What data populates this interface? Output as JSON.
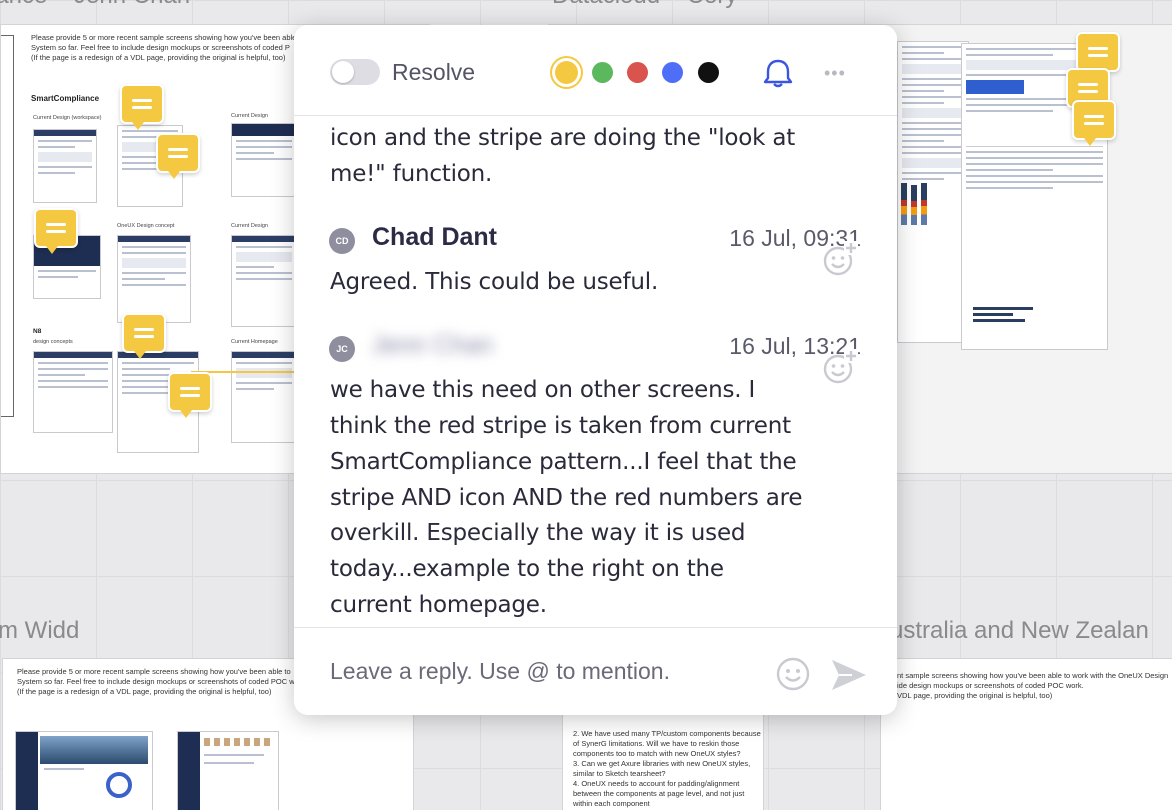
{
  "board": {
    "section_titles": [
      "iance – Jenn Chan",
      "Datacloud – Cory",
      "m Widd",
      "ustralia and New Zealan"
    ],
    "panel_left_instructions": [
      "Please provide 5 or more recent sample screens showing how you've been able",
      "System so far. Feel free to include  design mockups or screenshots of coded P",
      "(If the page is a redesign of a VDL page, providing the original is helpful, too)"
    ],
    "panel_left_heading": "SmartCompliance",
    "panel_left_labels": [
      "Current Design (workspace)",
      "Current Design",
      "OneUX Design concept",
      "Current Design"
    ],
    "panel_left_n8": "N8",
    "panel_left_n8_sub": "design concepts",
    "panel_left_homepage": "Current Homepage",
    "panel_bottom_left_instructions": [
      "Please provide 5 or more recent sample screens showing how you've been able to",
      "System so far. Feel free to include  design mockups or screenshots of coded POC w",
      "(If the page is a redesign of a VDL page, providing the original is helpful, too)"
    ],
    "panel_bottom_right_instructions": [
      "nt sample screens showing how you've been able to work with the OneUX Design",
      "ide  design mockups or screenshots of coded POC work.",
      "VDL page, providing the original is helpful, too)"
    ],
    "panel_bottom_mid_notes": [
      "2. We have used many TP/custom components because",
      "of SynerG limitations. Will we have to reskin those",
      "components too to match with new OneUX styles?",
      "3. Can we get Axure libraries with new OneUX styles,",
      "similar to Sketch tearsheet?",
      "4. OneUX needs to account for padding/alignment",
      "between the components at page level, and not just",
      "within each component"
    ]
  },
  "popup": {
    "resolve_label": "Resolve",
    "resolved": false,
    "colors": [
      "#f5c842",
      "#5cb85c",
      "#d9534f",
      "#4f6ef7",
      "#111111"
    ],
    "selected_color": "#f5c842",
    "more_label": "•••",
    "partial_comment_lines": [
      "icon and the stripe are doing the \"look at",
      "me!\" function."
    ],
    "comments": [
      {
        "initials": "CD",
        "author": "Chad Dant",
        "timestamp": "16 Jul, 09:31",
        "text": "Agreed. This could be useful."
      },
      {
        "initials": "JC",
        "author": "Jenn Chan",
        "timestamp": "16 Jul, 13:21",
        "lines": [
          "we have this need on other screens. I",
          "think the red stripe is taken from current",
          "SmartCompliance pattern...I feel that the",
          "stripe AND icon AND the red numbers are",
          "overkill. Especially the way it is used",
          "today...example to the right on the",
          "current homepage."
        ]
      }
    ],
    "reply_placeholder": "Leave a reply. Use @ to mention."
  },
  "icons": {
    "bell": "bell-icon",
    "more": "more-options-icon",
    "add_reaction": "add-reaction-icon",
    "emoji": "emoji-icon",
    "send": "send-icon"
  }
}
